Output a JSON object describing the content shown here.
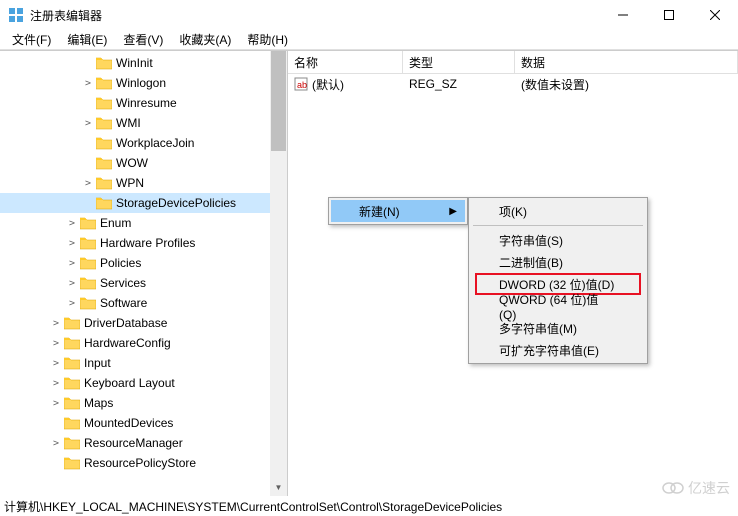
{
  "window": {
    "title": "注册表编辑器"
  },
  "menus": {
    "file": "文件(F)",
    "edit": "编辑(E)",
    "view": "查看(V)",
    "favorites": "收藏夹(A)",
    "help": "帮助(H)"
  },
  "tree": {
    "items": [
      {
        "indent": 5,
        "label": "WinInit",
        "expandable": false,
        "selected": false
      },
      {
        "indent": 5,
        "label": "Winlogon",
        "expandable": true,
        "expanded": false,
        "selected": false
      },
      {
        "indent": 5,
        "label": "Winresume",
        "expandable": false,
        "selected": false
      },
      {
        "indent": 5,
        "label": "WMI",
        "expandable": true,
        "expanded": false,
        "selected": false
      },
      {
        "indent": 5,
        "label": "WorkplaceJoin",
        "expandable": false,
        "selected": false
      },
      {
        "indent": 5,
        "label": "WOW",
        "expandable": false,
        "selected": false
      },
      {
        "indent": 5,
        "label": "WPN",
        "expandable": true,
        "expanded": false,
        "selected": false
      },
      {
        "indent": 5,
        "label": "StorageDevicePolicies",
        "expandable": false,
        "selected": true
      },
      {
        "indent": 4,
        "label": "Enum",
        "expandable": true,
        "expanded": false,
        "selected": false
      },
      {
        "indent": 4,
        "label": "Hardware Profiles",
        "expandable": true,
        "expanded": false,
        "selected": false
      },
      {
        "indent": 4,
        "label": "Policies",
        "expandable": true,
        "expanded": false,
        "selected": false
      },
      {
        "indent": 4,
        "label": "Services",
        "expandable": true,
        "expanded": false,
        "selected": false
      },
      {
        "indent": 4,
        "label": "Software",
        "expandable": true,
        "expanded": false,
        "selected": false
      },
      {
        "indent": 3,
        "label": "DriverDatabase",
        "expandable": true,
        "expanded": false,
        "selected": false
      },
      {
        "indent": 3,
        "label": "HardwareConfig",
        "expandable": true,
        "expanded": false,
        "selected": false
      },
      {
        "indent": 3,
        "label": "Input",
        "expandable": true,
        "expanded": false,
        "selected": false
      },
      {
        "indent": 3,
        "label": "Keyboard Layout",
        "expandable": true,
        "expanded": false,
        "selected": false
      },
      {
        "indent": 3,
        "label": "Maps",
        "expandable": true,
        "expanded": false,
        "selected": false
      },
      {
        "indent": 3,
        "label": "MountedDevices",
        "expandable": false,
        "selected": false
      },
      {
        "indent": 3,
        "label": "ResourceManager",
        "expandable": true,
        "expanded": false,
        "selected": false
      },
      {
        "indent": 3,
        "label": "ResourcePolicyStore",
        "expandable": false,
        "selected": false
      }
    ]
  },
  "list": {
    "columns": {
      "name": "名称",
      "type": "类型",
      "data": "数据"
    },
    "rows": [
      {
        "name": "(默认)",
        "type": "REG_SZ",
        "data": "(数值未设置)"
      }
    ]
  },
  "context_menu_1": {
    "new_label": "新建(N)"
  },
  "context_menu_2": {
    "items": [
      {
        "label": "项(K)",
        "highlighted": false,
        "boxed": false
      },
      {
        "label": "字符串值(S)",
        "highlighted": false,
        "boxed": false
      },
      {
        "label": "二进制值(B)",
        "highlighted": false,
        "boxed": false
      },
      {
        "label": "DWORD (32 位)值(D)",
        "highlighted": false,
        "boxed": true
      },
      {
        "label": "QWORD (64 位)值(Q)",
        "highlighted": false,
        "boxed": false
      },
      {
        "label": "多字符串值(M)",
        "highlighted": false,
        "boxed": false
      },
      {
        "label": "可扩充字符串值(E)",
        "highlighted": false,
        "boxed": false
      }
    ]
  },
  "statusbar": {
    "path": "计算机\\HKEY_LOCAL_MACHINE\\SYSTEM\\CurrentControlSet\\Control\\StorageDevicePolicies"
  },
  "watermark": {
    "text": "亿速云"
  }
}
